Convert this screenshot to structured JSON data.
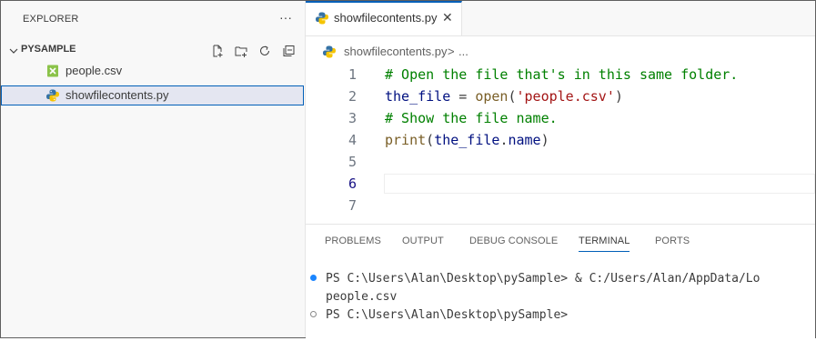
{
  "sidebar": {
    "title": "EXPLORER",
    "more_label": "···",
    "folder": {
      "name": "PYSAMPLE",
      "actions": [
        "new-file-icon",
        "new-folder-icon",
        "refresh-icon",
        "collapse-all-icon"
      ]
    },
    "files": [
      {
        "name": "people.csv",
        "icon": "csv-file-icon",
        "selected": false
      },
      {
        "name": "showfilecontents.py",
        "icon": "python-file-icon",
        "selected": true
      }
    ]
  },
  "editor": {
    "tab": {
      "label": "showfilecontents.py",
      "close": "✕"
    },
    "breadcrumb": {
      "file": "showfilecontents.py",
      "separator": ">",
      "more": "..."
    },
    "lines": [
      {
        "n": "1",
        "text": "# Open the file that's in this same folder."
      },
      {
        "n": "2",
        "text": "the_file = open('people.csv')"
      },
      {
        "n": "3",
        "text": "# Show the file name."
      },
      {
        "n": "4",
        "text": "print(the_file.name)"
      },
      {
        "n": "5",
        "text": ""
      },
      {
        "n": "6",
        "text": ""
      },
      {
        "n": "7",
        "text": ""
      }
    ],
    "current_line": 6
  },
  "panel": {
    "tabs": [
      "PROBLEMS",
      "OUTPUT",
      "DEBUG CONSOLE",
      "TERMINAL",
      "PORTS"
    ],
    "active_tab": "TERMINAL",
    "terminal": [
      "PS C:\\Users\\Alan\\Desktop\\pySample> & C:/Users/Alan/AppData/Lo",
      "people.csv",
      "PS C:\\Users\\Alan\\Desktop\\pySample>"
    ]
  },
  "colors": {
    "accent": "#005fb8",
    "comment": "#008000",
    "string": "#a31515",
    "function": "#795e26",
    "variable": "#001080"
  }
}
